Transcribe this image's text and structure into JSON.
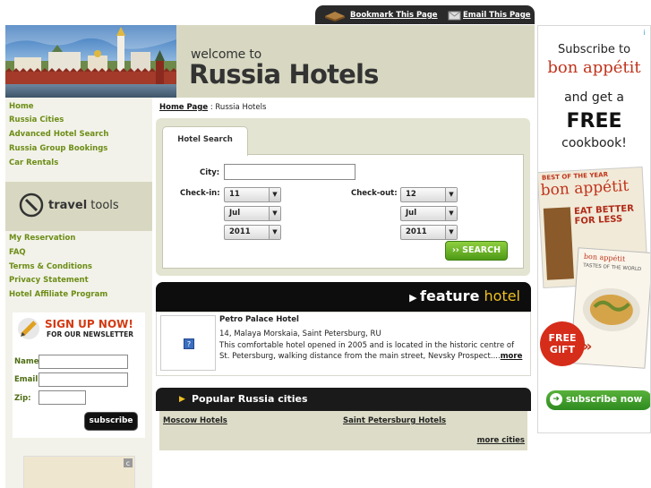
{
  "toolbar": {
    "bookmark_label": "Bookmark This Page",
    "email_label": "Email This Page"
  },
  "header": {
    "welcome": "welcome to",
    "brand": "Russia Hotels"
  },
  "nav": {
    "primary": [
      "Home",
      "Russia Cities",
      "Advanced Hotel Search",
      "Russia Group Bookings",
      "Car Rentals"
    ],
    "travel_tools_bold": "travel",
    "travel_tools_rest": " tools",
    "secondary": [
      "My Reservation",
      "FAQ",
      "Terms & Conditions",
      "Privacy Statement",
      "Hotel Affiliate Program"
    ]
  },
  "signup": {
    "title": "SIGN UP NOW!",
    "subtitle": "FOR OUR NEWSLETTER",
    "name_label": "Name:",
    "email_label": "Email:",
    "zip_label": "Zip:",
    "button": "subscribe"
  },
  "breadcrumb": {
    "home": "Home Page",
    "separator": " : ",
    "current": "Russia Hotels"
  },
  "search": {
    "tab": "Hotel Search",
    "city_label": "City:",
    "city_value": "",
    "checkin_label": "Check-in:",
    "checkout_label": "Check-out:",
    "checkin": {
      "day": "11",
      "month": "Jul",
      "year": "2011"
    },
    "checkout": {
      "day": "12",
      "month": "Jul",
      "year": "2011"
    },
    "button": "SEARCH"
  },
  "feature": {
    "title_bold": "feature",
    "title_hl": " hotel",
    "hotel_name": "Petro Palace Hotel",
    "address": "14, Malaya Morskaia, Saint Petersburg, RU",
    "description": "This comfortable hotel opened in 2005 and is located in the historic centre of St. Petersburg, walking distance from the main street, Nevsky Prospect....",
    "more": "more",
    "image_placeholder": "?"
  },
  "popular": {
    "title": "Popular Russia cities",
    "cities": [
      "Moscow Hotels",
      "Saint Petersburg Hotels"
    ],
    "more": "more cities"
  },
  "ad": {
    "line1": "Subscribe to",
    "brand": "bon appétit",
    "line2": "and get a",
    "free": "FREE",
    "line3": "cookbook!",
    "mag_header": "BEST OF THE YEAR",
    "mag_brand": "bon appétit",
    "mag_headline": "EAT BETTER FOR LESS",
    "mag2_title": "TASTES OF THE WORLD",
    "badge": "FREE GIFT",
    "button": "subscribe now"
  },
  "colors": {
    "nav_green": "#6d8d16",
    "header_beige": "#d8d8c2",
    "search_green": "#4e9a16",
    "feature_yellow": "#f0c020"
  }
}
